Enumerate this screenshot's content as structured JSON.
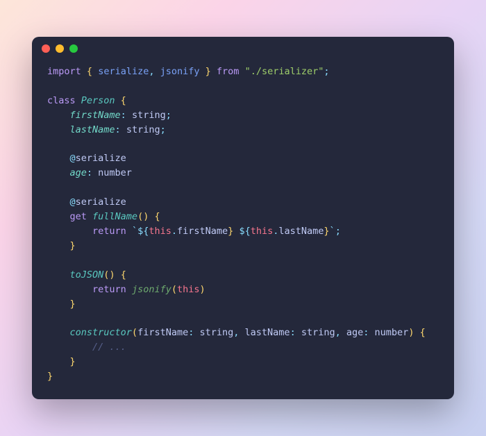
{
  "code": {
    "import_kw": "import",
    "import_open": "{ ",
    "import_fn1": "serialize",
    "import_comma": ", ",
    "import_fn2": "jsonify",
    "import_close": " }",
    "from_kw": " from ",
    "import_path": "\"./serializer\"",
    "semi": ";",
    "class_kw": "class",
    "class_name": " Person ",
    "brace_open": "{",
    "brace_close": "}",
    "prop_firstName": "firstName",
    "prop_lastName": "lastName",
    "prop_age": "age",
    "colon_space": ": ",
    "type_string": "string",
    "type_number": "number",
    "decorator_at": "@",
    "decorator_name": "serialize",
    "get_kw": "get",
    "method_fullName": " fullName",
    "method_toJSON": "toJSON",
    "method_constructor": "constructor",
    "paren_open": "(",
    "paren_close": ")",
    "space_brace": " {",
    "return_kw": "return",
    "backtick": "`",
    "interp_open": "${",
    "interp_close": "}",
    "this_kw": "this",
    "dot": ".",
    "space": " ",
    "call_jsonify": "jsonify",
    "param_firstName": "firstName",
    "param_lastName": "lastName",
    "param_age": "age",
    "comma_space": ", ",
    "comment": "// ..."
  }
}
